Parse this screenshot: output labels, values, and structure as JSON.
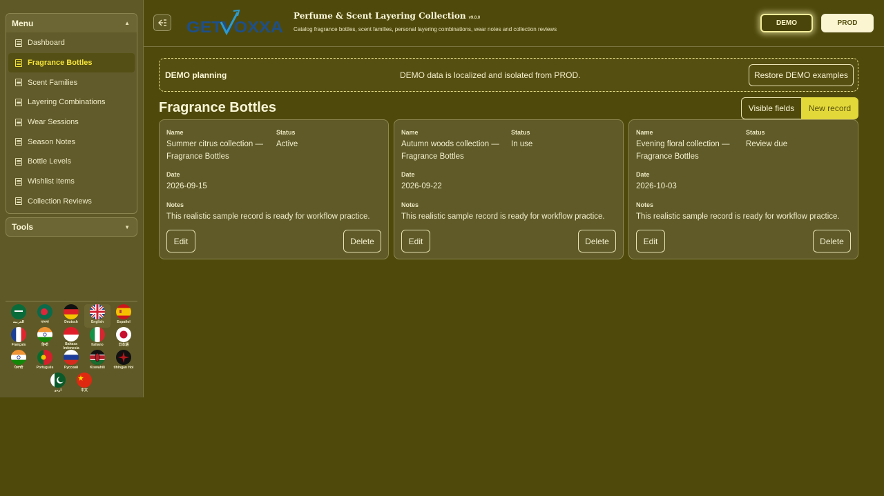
{
  "sidebar": {
    "menu_title": "Menu",
    "items": [
      {
        "label": "Dashboard"
      },
      {
        "label": "Fragrance Bottles"
      },
      {
        "label": "Scent Families"
      },
      {
        "label": "Layering Combinations"
      },
      {
        "label": "Wear Sessions"
      },
      {
        "label": "Season Notes"
      },
      {
        "label": "Bottle Levels"
      },
      {
        "label": "Wishlist Items"
      },
      {
        "label": "Collection Reviews"
      }
    ],
    "active_index": 1,
    "tools_title": "Tools",
    "languages": [
      {
        "label": "العربية",
        "flag": "saudi-arabia-flag-icon"
      },
      {
        "label": "বাংলা",
        "flag": "bangladesh-flag-icon"
      },
      {
        "label": "Deutsch",
        "flag": "germany-flag-icon"
      },
      {
        "label": "English",
        "flag": "uk-flag-icon"
      },
      {
        "label": "Español",
        "flag": "spain-flag-icon"
      },
      {
        "label": "Français",
        "flag": "france-flag-icon"
      },
      {
        "label": "हिन्दी",
        "flag": "india-flag-icon"
      },
      {
        "label": "Bahasa Indonesia",
        "flag": "indonesia-flag-icon"
      },
      {
        "label": "Italiano",
        "flag": "italy-flag-icon"
      },
      {
        "label": "日本語",
        "flag": "japan-flag-icon"
      },
      {
        "label": "ਪੰਜਾਬੀ",
        "flag": "india-flag-icon"
      },
      {
        "label": "Português",
        "flag": "portugal-flag-icon"
      },
      {
        "label": "Русский",
        "flag": "russia-flag-icon"
      },
      {
        "label": "Kiswahili",
        "flag": "kenya-flag-icon"
      },
      {
        "label": "tlhIngan Hol",
        "flag": "klingon-flag-icon"
      },
      {
        "label": "اردو",
        "flag": "pakistan-flag-icon"
      },
      {
        "label": "中文",
        "flag": "china-flag-icon"
      }
    ],
    "selected_language": "English"
  },
  "header": {
    "logo_text": "GETVOXXA",
    "title": "Perfume & Scent Layering Collection",
    "version": "v9.0.0",
    "subtitle": "Catalog fragrance bottles, scent families, personal layering combinations, wear notes and collection reviews",
    "env_demo": "DEMO",
    "env_prod": "PROD",
    "active_env": "DEMO"
  },
  "demo_bar": {
    "title": "DEMO planning",
    "message": "DEMO data is localized and isolated from PROD.",
    "restore_label": "Restore DEMO examples"
  },
  "section": {
    "title": "Fragrance Bottles",
    "visible_fields_label": "Visible fields",
    "new_record_label": "New record"
  },
  "labels": {
    "name": "Name",
    "status": "Status",
    "date": "Date",
    "notes": "Notes",
    "edit": "Edit",
    "delete": "Delete"
  },
  "records": [
    {
      "name_line1": "Summer citrus collection —",
      "name_line2": "Fragrance Bottles",
      "status": "Active",
      "date": "2026-09-15",
      "notes": "This realistic sample record is ready for workflow practice."
    },
    {
      "name_line1": "Autumn woods collection —",
      "name_line2": "Fragrance Bottles",
      "status": "In use",
      "date": "2026-09-22",
      "notes": "This realistic sample record is ready for workflow practice."
    },
    {
      "name_line1": "Evening floral collection —",
      "name_line2": "Fragrance Bottles",
      "status": "Review due",
      "date": "2026-10-03",
      "notes": "This realistic sample record is ready for workflow practice."
    }
  ],
  "colors": {
    "background": "#4f4a0c",
    "accent": "#e3d83a",
    "active_menu_text": "#f5e43b"
  }
}
